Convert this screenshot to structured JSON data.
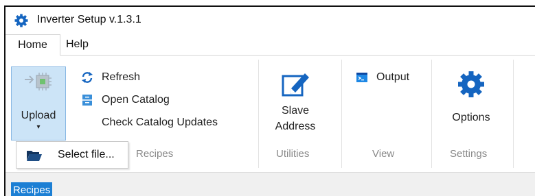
{
  "window": {
    "title": "Inverter Setup v.1.3.1",
    "icon": "gear-icon"
  },
  "menu": {
    "home": "Home",
    "help": "Help"
  },
  "ribbon": {
    "upload": {
      "label": "Upload",
      "caret": "▾",
      "icon": "chip-upload-icon"
    },
    "refresh": {
      "label": "Refresh",
      "icon": "refresh-icon"
    },
    "open_catalog": {
      "label": "Open Catalog",
      "icon": "catalog-icon"
    },
    "check_updates": {
      "label": "Check Catalog Updates"
    },
    "slave_address": {
      "line1": "Slave",
      "line2": "Address",
      "icon": "edit-icon"
    },
    "output": {
      "label": "Output",
      "icon": "terminal-icon"
    },
    "options": {
      "label": "Options",
      "icon": "gear-icon"
    },
    "groups": {
      "recipes": "Recipes",
      "utilities": "Utilities",
      "view": "View",
      "settings": "Settings"
    }
  },
  "dropdown": {
    "select_file": "Select file...",
    "icon": "folder-open-icon"
  },
  "bottom": {
    "recipes_tab": "Recipes"
  },
  "colors": {
    "accent": "#1c7fd4",
    "upload_bg": "#cce4f7",
    "group_label": "#888888"
  }
}
